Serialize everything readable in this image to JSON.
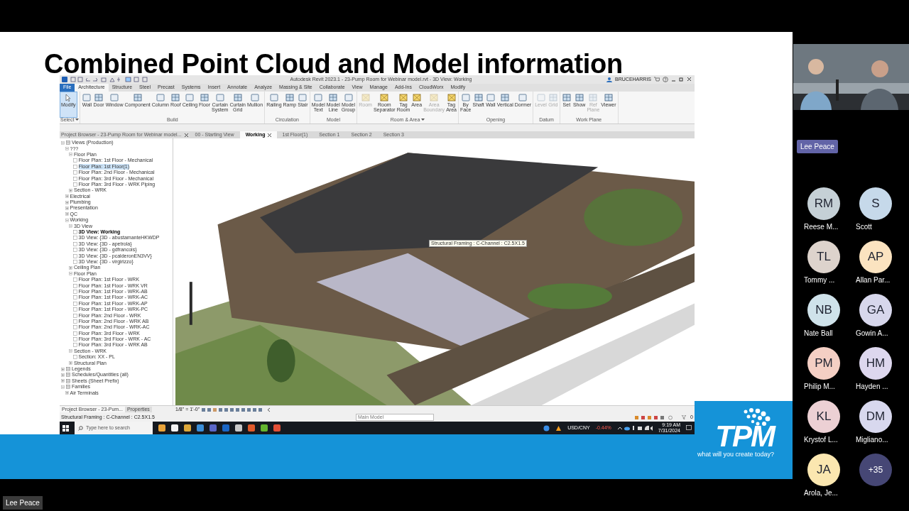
{
  "slide": {
    "title": "Combined Point Cloud and Model information",
    "revit": {
      "title_bar": {
        "title": "Autodesk Revit 2023.1 - 23-Pump Room for Webinar model.rvt - 3D View: Working",
        "user": "BRUCEHARRIS"
      },
      "ribbon_tabs": [
        {
          "label": "File",
          "selected": false,
          "kind": "file"
        },
        {
          "label": "Architecture",
          "selected": true,
          "kind": "tab"
        },
        {
          "label": "Structure",
          "selected": false,
          "kind": "tab"
        },
        {
          "label": "Steel",
          "selected": false,
          "kind": "tab"
        },
        {
          "label": "Precast",
          "selected": false,
          "kind": "tab"
        },
        {
          "label": "Systems",
          "selected": false,
          "kind": "tab"
        },
        {
          "label": "Insert",
          "selected": false,
          "kind": "tab"
        },
        {
          "label": "Annotate",
          "selected": false,
          "kind": "tab"
        },
        {
          "label": "Analyze",
          "selected": false,
          "kind": "tab"
        },
        {
          "label": "Massing & Site",
          "selected": false,
          "kind": "tab"
        },
        {
          "label": "Collaborate",
          "selected": false,
          "kind": "tab"
        },
        {
          "label": "View",
          "selected": false,
          "kind": "tab"
        },
        {
          "label": "Manage",
          "selected": false,
          "kind": "tab"
        },
        {
          "label": "Add-Ins",
          "selected": false,
          "kind": "tab"
        },
        {
          "label": "CloudWorx",
          "selected": false,
          "kind": "tab"
        },
        {
          "label": "Modify",
          "selected": false,
          "kind": "tab"
        }
      ],
      "ribbon_panels": [
        {
          "title": "Select",
          "dropdown": true,
          "buttons": [
            {
              "label": "Modify",
              "selected": true,
              "disabled": false
            }
          ]
        },
        {
          "title": "Build",
          "dropdown": false,
          "buttons": [
            {
              "label": "Wall",
              "selected": false,
              "disabled": false
            },
            {
              "label": "Door",
              "selected": false,
              "disabled": false
            },
            {
              "label": "Window",
              "selected": false,
              "disabled": false
            },
            {
              "label": "Component",
              "selected": false,
              "disabled": false
            },
            {
              "label": "Column",
              "selected": false,
              "disabled": false
            },
            {
              "label": "Roof",
              "selected": false,
              "disabled": false
            },
            {
              "label": "Ceiling",
              "selected": false,
              "disabled": false
            },
            {
              "label": "Floor",
              "selected": false,
              "disabled": false
            },
            {
              "label": "Curtain System",
              "selected": false,
              "disabled": false
            },
            {
              "label": "Curtain Grid",
              "selected": false,
              "disabled": false
            },
            {
              "label": "Mullion",
              "selected": false,
              "disabled": false
            }
          ]
        },
        {
          "title": "Circulation",
          "dropdown": false,
          "buttons": [
            {
              "label": "Railing",
              "selected": false,
              "disabled": false
            },
            {
              "label": "Ramp",
              "selected": false,
              "disabled": false
            },
            {
              "label": "Stair",
              "selected": false,
              "disabled": false
            }
          ]
        },
        {
          "title": "Model",
          "dropdown": false,
          "buttons": [
            {
              "label": "Model Text",
              "selected": false,
              "disabled": false
            },
            {
              "label": "Model Line",
              "selected": false,
              "disabled": false
            },
            {
              "label": "Model Group",
              "selected": false,
              "disabled": false
            }
          ]
        },
        {
          "title": "Room & Area",
          "dropdown": true,
          "buttons": [
            {
              "label": "Room",
              "selected": false,
              "disabled": true
            },
            {
              "label": "Room Separator",
              "selected": false,
              "disabled": false
            },
            {
              "label": "Tag Room",
              "selected": false,
              "disabled": false
            },
            {
              "label": "Area",
              "selected": false,
              "disabled": false
            },
            {
              "label": "Area Boundary",
              "selected": false,
              "disabled": true
            },
            {
              "label": "Tag Area",
              "selected": false,
              "disabled": false
            }
          ]
        },
        {
          "title": "Opening",
          "dropdown": false,
          "buttons": [
            {
              "label": "By Face",
              "selected": false,
              "disabled": false
            },
            {
              "label": "Shaft",
              "selected": false,
              "disabled": false
            },
            {
              "label": "Wall",
              "selected": false,
              "disabled": false
            },
            {
              "label": "Vertical",
              "selected": false,
              "disabled": false
            },
            {
              "label": "Dormer",
              "selected": false,
              "disabled": false
            }
          ]
        },
        {
          "title": "Datum",
          "dropdown": false,
          "buttons": [
            {
              "label": "Level",
              "selected": false,
              "disabled": true
            },
            {
              "label": "Grid",
              "selected": false,
              "disabled": true
            }
          ]
        },
        {
          "title": "Work Plane",
          "dropdown": false,
          "buttons": [
            {
              "label": "Set",
              "selected": false,
              "disabled": false
            },
            {
              "label": "Show",
              "selected": false,
              "disabled": false
            },
            {
              "label": "Ref Plane",
              "selected": false,
              "disabled": true
            },
            {
              "label": "Viewer",
              "selected": false,
              "disabled": false
            }
          ]
        }
      ],
      "browser_title": "Project Browser - 23-Pump Room for Webinar model...",
      "view_tabs": [
        {
          "label": "00 - Starting View",
          "selected": false,
          "closable": false
        },
        {
          "label": "Working",
          "selected": true,
          "closable": true
        },
        {
          "label": "1st Floor(1)",
          "selected": false,
          "closable": false
        },
        {
          "label": "Section 1",
          "selected": false,
          "closable": false
        },
        {
          "label": "Section 2",
          "selected": false,
          "closable": false
        },
        {
          "label": "Section 3",
          "selected": false,
          "closable": false
        }
      ],
      "tree": [
        {
          "label": "Views (Production)",
          "kind": "category",
          "expanded": true,
          "children": [
            {
              "label": "???",
              "kind": "group",
              "expanded": true,
              "children": [
                {
                  "label": "Floor Plan",
                  "kind": "group",
                  "expanded": true,
                  "children": [
                    {
                      "label": "Floor Plan: 1st Floor - Mechanical",
                      "kind": "view",
                      "selected": false,
                      "current": false
                    },
                    {
                      "label": "Floor Plan: 1st Floor(1)",
                      "kind": "view",
                      "selected": true,
                      "current": false
                    },
                    {
                      "label": "Floor Plan: 2nd Floor - Mechanical",
                      "kind": "view",
                      "selected": false,
                      "current": false
                    },
                    {
                      "label": "Floor Plan: 3rd Floor - Mechanical",
                      "kind": "view",
                      "selected": false,
                      "current": false
                    },
                    {
                      "label": "Floor Plan: 3rd Floor - WRK Piping",
                      "kind": "view",
                      "selected": false,
                      "current": false
                    }
                  ]
                },
                {
                  "label": "Section - WRK",
                  "kind": "group",
                  "expanded": false
                }
              ]
            },
            {
              "label": "Electrical",
              "kind": "group",
              "expanded": false
            },
            {
              "label": "Plumbing",
              "kind": "group",
              "expanded": false
            },
            {
              "label": "Presentation",
              "kind": "group",
              "expanded": false
            },
            {
              "label": "QC",
              "kind": "group",
              "expanded": false
            },
            {
              "label": "Working",
              "kind": "group",
              "expanded": true,
              "children": [
                {
                  "label": "3D View",
                  "kind": "group",
                  "expanded": true,
                  "children": [
                    {
                      "label": "3D View: Working",
                      "kind": "view",
                      "selected": false,
                      "current": true
                    },
                    {
                      "label": "3D View: {3D - abustamanteHKWDP",
                      "kind": "view",
                      "selected": false,
                      "current": false
                    },
                    {
                      "label": "3D View: {3D - apetrola}",
                      "kind": "view",
                      "selected": false,
                      "current": false
                    },
                    {
                      "label": "3D View: {3D - gdfrancois}",
                      "kind": "view",
                      "selected": false,
                      "current": false
                    },
                    {
                      "label": "3D View: {3D - pcalderonEN3VV}",
                      "kind": "view",
                      "selected": false,
                      "current": false
                    },
                    {
                      "label": "3D View: {3D - virgirizzo}",
                      "kind": "view",
                      "selected": false,
                      "current": false
                    }
                  ]
                },
                {
                  "label": "Ceiling Plan",
                  "kind": "group",
                  "expanded": false
                },
                {
                  "label": "Floor Plan",
                  "kind": "group",
                  "expanded": true,
                  "children": [
                    {
                      "label": "Floor Plan: 1st Floor - WRK",
                      "kind": "view",
                      "selected": false,
                      "current": false
                    },
                    {
                      "label": "Floor Plan: 1st Floor - WRK VR",
                      "kind": "view",
                      "selected": false,
                      "current": false
                    },
                    {
                      "label": "Floor Plan: 1st Floor - WRK-AB",
                      "kind": "view",
                      "selected": false,
                      "current": false
                    },
                    {
                      "label": "Floor Plan: 1st Floor - WRK-AC",
                      "kind": "view",
                      "selected": false,
                      "current": false
                    },
                    {
                      "label": "Floor Plan: 1st Floor - WRK-AP",
                      "kind": "view",
                      "selected": false,
                      "current": false
                    },
                    {
                      "label": "Floor Plan: 1st Floor - WRK-PC",
                      "kind": "view",
                      "selected": false,
                      "current": false
                    },
                    {
                      "label": "Floor Plan: 2nd Floor - WRK",
                      "kind": "view",
                      "selected": false,
                      "current": false
                    },
                    {
                      "label": "Floor Plan: 2nd Floor - WRK AB",
                      "kind": "view",
                      "selected": false,
                      "current": false
                    },
                    {
                      "label": "Floor Plan: 2nd Floor - WRK-AC",
                      "kind": "view",
                      "selected": false,
                      "current": false
                    },
                    {
                      "label": "Floor Plan: 3rd Floor - WRK",
                      "kind": "view",
                      "selected": false,
                      "current": false
                    },
                    {
                      "label": "Floor Plan: 3rd Floor - WRK - AC",
                      "kind": "view",
                      "selected": false,
                      "current": false
                    },
                    {
                      "label": "Floor Plan: 3rd Floor - WRK AB",
                      "kind": "view",
                      "selected": false,
                      "current": false
                    }
                  ]
                },
                {
                  "label": "Section - WRK",
                  "kind": "group",
                  "expanded": true,
                  "children": [
                    {
                      "label": "Section: XX - PL",
                      "kind": "view",
                      "selected": false,
                      "current": false
                    }
                  ]
                },
                {
                  "label": "Structural Plan",
                  "kind": "group",
                  "expanded": false
                }
              ]
            }
          ]
        },
        {
          "label": "Legends",
          "kind": "category",
          "expanded": false
        },
        {
          "label": "Schedules/Quantities (all)",
          "kind": "category",
          "expanded": false
        },
        {
          "label": "Sheets (Sheet Prefix)",
          "kind": "category",
          "expanded": false
        },
        {
          "label": "Families",
          "kind": "category",
          "expanded": true,
          "children": [
            {
              "label": "Air Terminals",
              "kind": "group",
              "expanded": false
            }
          ]
        }
      ],
      "browser_tabs": [
        {
          "label": "Project Browser - 23-Pum...",
          "selected": true
        },
        {
          "label": "Properties",
          "selected": false
        }
      ],
      "tooltip": "Structural Framing : C-Channel : C2.5X1.5",
      "scale": "1/8\" = 1'-0\"",
      "status_bar": {
        "text": "Structural Framing : C-Channel : C2.5X1.5",
        "model": "Main Model",
        "filter_count": "0"
      },
      "taskbar": {
        "search_placeholder": "Type here to search",
        "ticker": "USD/CNY",
        "change": "-0.44%",
        "time": "9:19 AM",
        "date": "7/31/2024"
      }
    },
    "logo": {
      "name": "TPM",
      "tagline": "what will you create today?"
    }
  },
  "speaker_label": "Lee Peace",
  "participants": [
    {
      "kind": "person",
      "initials": "RM",
      "name": "Reese M...",
      "color": "#c5d0d6"
    },
    {
      "kind": "person",
      "initials": "S",
      "name": "Scott",
      "color": "#c6d9ea"
    },
    {
      "kind": "person",
      "initials": "TL",
      "name": "Tommy ...",
      "color": "#ddd3cc"
    },
    {
      "kind": "person",
      "initials": "AP",
      "name": "Allan Par...",
      "color": "#fbe3c0"
    },
    {
      "kind": "person",
      "initials": "NB",
      "name": "Nate Ball",
      "color": "#cfe2ea"
    },
    {
      "kind": "person",
      "initials": "GA",
      "name": "Gowin A...",
      "color": "#d7d7ec"
    },
    {
      "kind": "person",
      "initials": "PM",
      "name": "Philip M...",
      "color": "#f4cfc4"
    },
    {
      "kind": "person",
      "initials": "HM",
      "name": "Hayden ...",
      "color": "#ddd7ee"
    },
    {
      "kind": "person",
      "initials": "KL",
      "name": "Krystof L...",
      "color": "#ecd0d4"
    },
    {
      "kind": "person",
      "initials": "DM",
      "name": "Migliano...",
      "color": "#d8d8ee"
    },
    {
      "kind": "person",
      "initials": "JA",
      "name": "Arola, Je...",
      "color": "#fbe7b0"
    },
    {
      "kind": "overflow",
      "initials": "+35",
      "color": "#464775"
    }
  ],
  "presenter_label": "Lee Peace"
}
